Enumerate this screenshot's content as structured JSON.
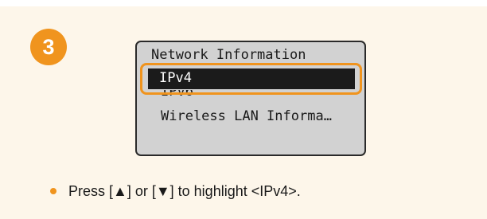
{
  "step": {
    "number": "3"
  },
  "screen": {
    "title": "Network Information",
    "items": [
      "IPv4",
      "IPv6",
      "Wireless LAN Informa…"
    ],
    "selected_index": 0
  },
  "instruction": {
    "text": "Press [▲] or [▼] to highlight <IPv4>."
  },
  "colors": {
    "accent": "#f0941e",
    "panel_background": "#fdf6ea",
    "screen_background": "#d2d2d2",
    "selection_background": "#1b1b1b"
  }
}
